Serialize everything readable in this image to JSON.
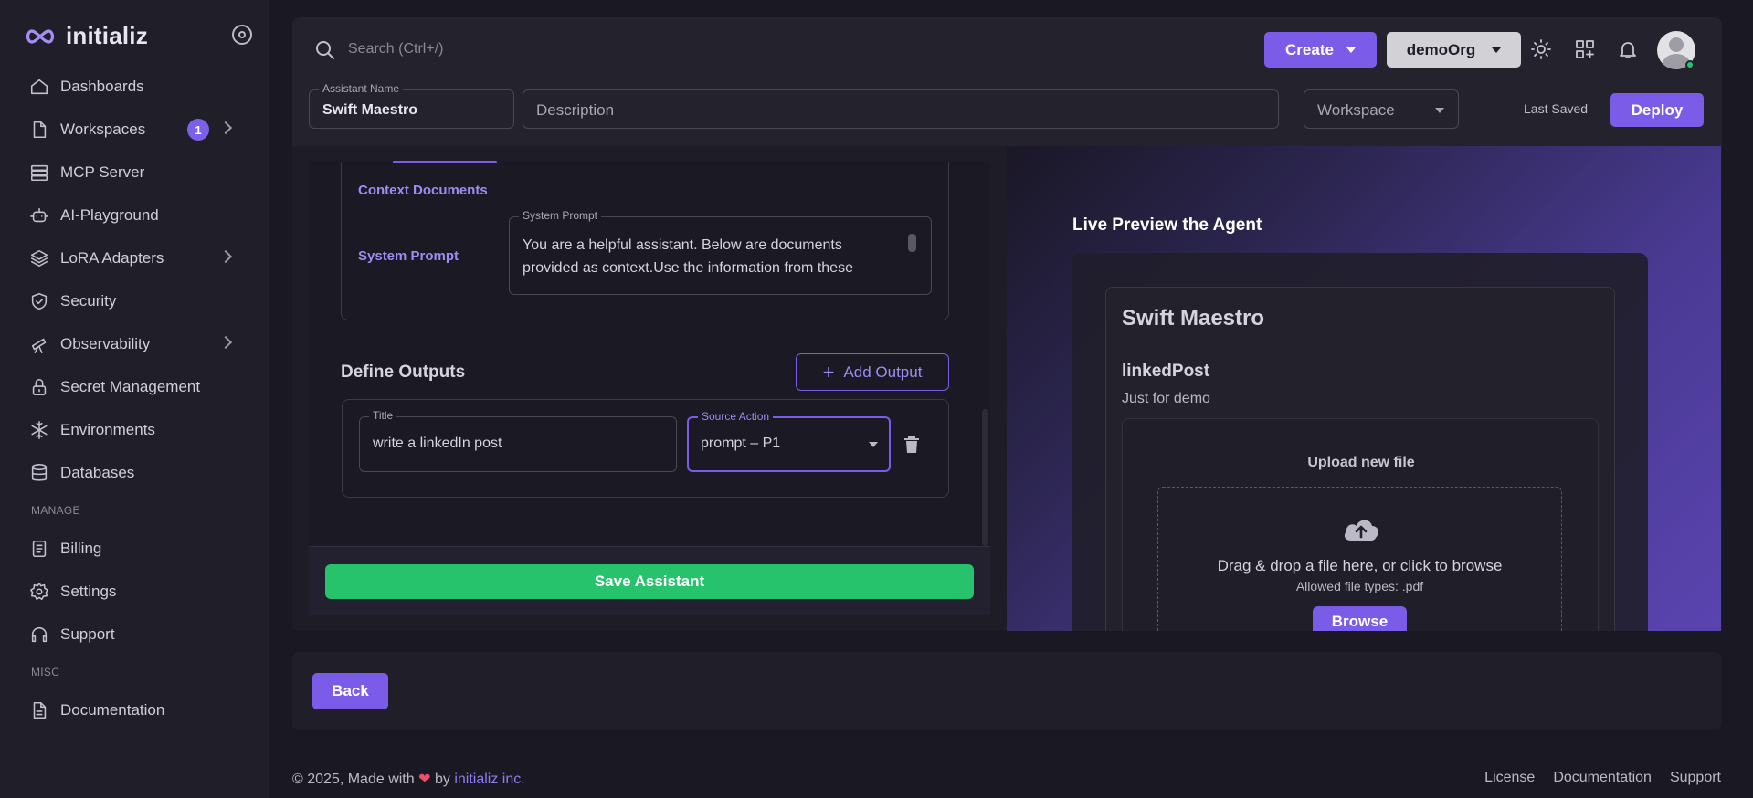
{
  "brand": {
    "name": "initializ",
    "accent": "#7b5ce8",
    "success": "#27c26c"
  },
  "sidebar": {
    "items": [
      {
        "label": "Dashboards",
        "icon": "home-icon"
      },
      {
        "label": "Workspaces",
        "icon": "file-icon",
        "badge": "1"
      },
      {
        "label": "MCP Server",
        "icon": "server-icon"
      },
      {
        "label": "AI-Playground",
        "icon": "robot-icon"
      },
      {
        "label": "LoRA Adapters",
        "icon": "layers-icon"
      },
      {
        "label": "Security",
        "icon": "shield-icon"
      },
      {
        "label": "Observability",
        "icon": "telescope-icon"
      },
      {
        "label": "Secret Management",
        "icon": "lock-icon"
      },
      {
        "label": "Environments",
        "icon": "snowflake-icon"
      },
      {
        "label": "Databases",
        "icon": "database-icon"
      }
    ],
    "manage_label": "MANAGE",
    "manage_items": [
      {
        "label": "Billing",
        "icon": "receipt-icon"
      },
      {
        "label": "Settings",
        "icon": "gear-icon"
      },
      {
        "label": "Support",
        "icon": "headset-icon"
      }
    ],
    "misc_label": "MISC",
    "misc_items": [
      {
        "label": "Documentation",
        "icon": "document-icon"
      }
    ]
  },
  "header": {
    "search_placeholder": "Search (Ctrl+/)",
    "create_label": "Create",
    "org_label": "demoOrg"
  },
  "assistant": {
    "name_label": "Assistant Name",
    "name_value": "Swift Maestro",
    "description_placeholder": "Description",
    "workspace_placeholder": "Workspace",
    "last_saved": "Last Saved —",
    "deploy_label": "Deploy"
  },
  "config": {
    "context_documents": "Context Documents",
    "system_prompt_link": "System Prompt",
    "system_prompt_label": "System Prompt",
    "system_prompt_text": "You are a helpful assistant. Below are documents provided as context.Use the information from these"
  },
  "outputs": {
    "title": "Define Outputs",
    "add_label": "Add Output",
    "title_field_label": "Title",
    "title_field_value": "write a linkedIn post",
    "source_label": "Source Action",
    "source_value": "prompt – P1"
  },
  "save_label": "Save Assistant",
  "preview": {
    "title": "Live Preview the Agent",
    "agent_name": "Swift Maestro",
    "output_name": "linkedPost",
    "output_desc": "Just for demo",
    "upload_title": "Upload new file",
    "drop_text": "Drag & drop a file here, or click to browse",
    "allowed_types": "Allowed file types: .pdf",
    "browse_label": "Browse"
  },
  "back_label": "Back",
  "footer": {
    "copyright": "© 2025, Made with",
    "by": "by",
    "company": "initializ inc.",
    "links": [
      "License",
      "Documentation",
      "Support"
    ]
  }
}
